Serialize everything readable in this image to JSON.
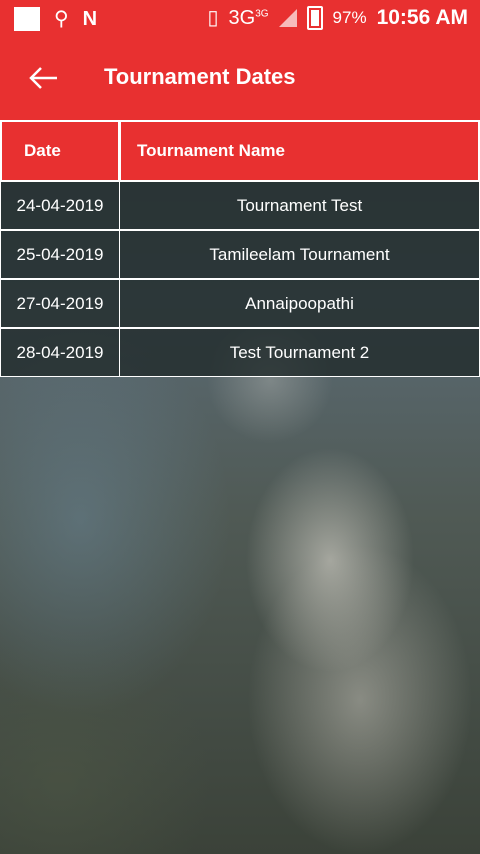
{
  "status_bar": {
    "network": "3G",
    "network_sup": "3G",
    "battery": "97%",
    "time": "10:56 AM"
  },
  "app_bar": {
    "title": "Tournament Dates"
  },
  "table": {
    "headers": [
      "Date",
      "Tournament Name"
    ],
    "rows": [
      {
        "date": "24-04-2019",
        "name": "Tournament Test"
      },
      {
        "date": "25-04-2019",
        "name": "Tamileelam Tournament"
      },
      {
        "date": "27-04-2019",
        "name": "Annaipoopathi"
      },
      {
        "date": "28-04-2019",
        "name": "Test Tournament 2"
      }
    ]
  },
  "colors": {
    "accent": "#e83030",
    "row_bg": "#202a2a"
  }
}
